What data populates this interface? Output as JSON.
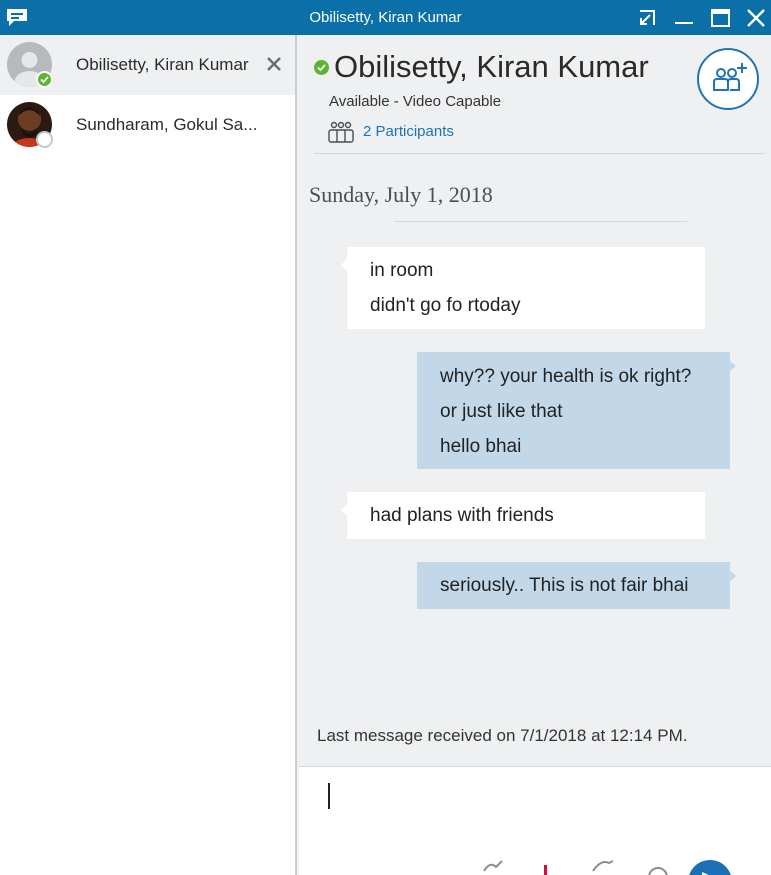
{
  "window": {
    "title": "Obilisetty, Kiran Kumar",
    "icons": [
      "chat-app-icon",
      "popout-icon",
      "minimize-icon",
      "maximize-icon",
      "close-icon"
    ],
    "accent": "#0b70a8"
  },
  "sidebar": {
    "conversations": [
      {
        "name": "Obilisetty, Kiran Kumar",
        "presence": "available",
        "active": true
      },
      {
        "name": "Sundharam, Gokul Sa...",
        "presence": "unknown",
        "active": false
      }
    ]
  },
  "header": {
    "name": "Obilisetty, Kiran Kumar",
    "status": "Available - Video Capable",
    "participants": "2 Participants",
    "presence_color": "#5cb531"
  },
  "conversation": {
    "date": "Sunday, July 1, 2018",
    "messages": [
      {
        "direction": "incoming",
        "lines": [
          "in room",
          "didn't go fo rtoday"
        ]
      },
      {
        "direction": "outgoing",
        "lines": [
          "why?? your health is ok right?",
          "or just like that",
          "hello bhai"
        ]
      },
      {
        "direction": "incoming",
        "lines": [
          "had plans with friends"
        ]
      },
      {
        "direction": "outgoing",
        "lines": [
          "seriously.. This is not fair bhai"
        ]
      }
    ],
    "last_message": "Last message received on 7/1/2018 at 12:14 PM."
  },
  "compose": {
    "value": "",
    "tools": [
      "pen-icon",
      "emoticon-icon",
      "send-icon"
    ],
    "send_color": "#1a6fb5"
  }
}
